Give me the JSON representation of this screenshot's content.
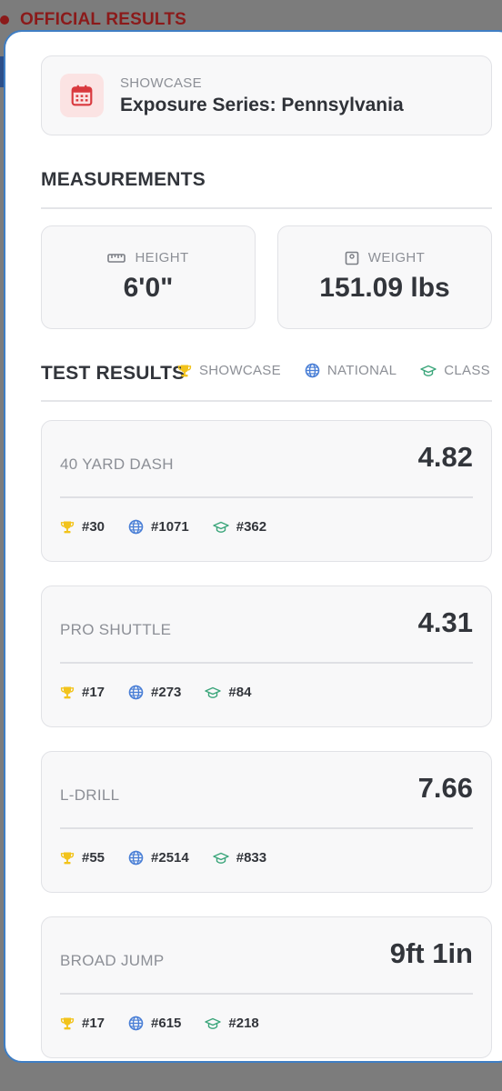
{
  "background": {
    "header_title": "OFFICIAL RESULTS"
  },
  "showcase": {
    "label": "SHOWCASE",
    "name": "Exposure Series: Pennsylvania",
    "icon": "calendar-icon"
  },
  "measurements": {
    "title": "MEASUREMENTS",
    "height": {
      "label": "HEIGHT",
      "value": "6'0\"",
      "icon": "ruler-icon"
    },
    "weight": {
      "label": "WEIGHT",
      "value": "151.09 lbs",
      "icon": "scale-icon"
    }
  },
  "test_results": {
    "title": "TEST RESULTS",
    "legend": {
      "showcase": "SHOWCASE",
      "national": "NATIONAL",
      "class": "CLASS"
    },
    "tests": [
      {
        "name": "40 YARD DASH",
        "value": "4.82",
        "showcase_rank": "#30",
        "national_rank": "#1071",
        "class_rank": "#362"
      },
      {
        "name": "PRO SHUTTLE",
        "value": "4.31",
        "showcase_rank": "#17",
        "national_rank": "#273",
        "class_rank": "#84"
      },
      {
        "name": "L-DRILL",
        "value": "7.66",
        "showcase_rank": "#55",
        "national_rank": "#2514",
        "class_rank": "#833"
      },
      {
        "name": "BROAD JUMP",
        "value": "9ft 1in",
        "showcase_rank": "#17",
        "national_rank": "#615",
        "class_rank": "#218"
      }
    ]
  },
  "colors": {
    "trophy": "#f2c31b",
    "globe": "#4a7fd6",
    "cap": "#3aa57a",
    "calendar": "#d9393e",
    "modal_border": "#3f7ec4"
  }
}
